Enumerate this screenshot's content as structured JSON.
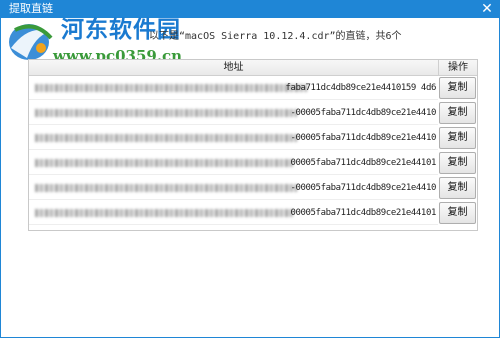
{
  "window": {
    "title": "提取直链",
    "close_symbol": "✕"
  },
  "watermark": {
    "title": "河东软件园",
    "url": "www.pc0359.cn"
  },
  "summary_text": "以下是“macOS Sierra 10.12.4.cdr”的直链，共6个",
  "table": {
    "headers": {
      "address": "地址",
      "action": "操作"
    },
    "rows": [
      {
        "address_suffix": "faba711dc4db89ce21e4410159 4d6",
        "copy_label": "复制"
      },
      {
        "address_suffix": "-00005faba711dc4db89ce21e4410",
        "copy_label": "复制"
      },
      {
        "address_suffix": "-00005faba711dc4db89ce21e4410",
        "copy_label": "复制"
      },
      {
        "address_suffix": "00005faba711dc4db89ce21e44101",
        "copy_label": "复制"
      },
      {
        "address_suffix": "-00005faba711dc4db89ce21e4410",
        "copy_label": "复制"
      },
      {
        "address_suffix": "00005faba711dc4db89ce21e44101",
        "copy_label": "复制"
      }
    ]
  },
  "colors": {
    "titlebar": "#1f86d6",
    "watermark_blue": "#1a7ad0",
    "watermark_green": "#3a9a3a"
  }
}
